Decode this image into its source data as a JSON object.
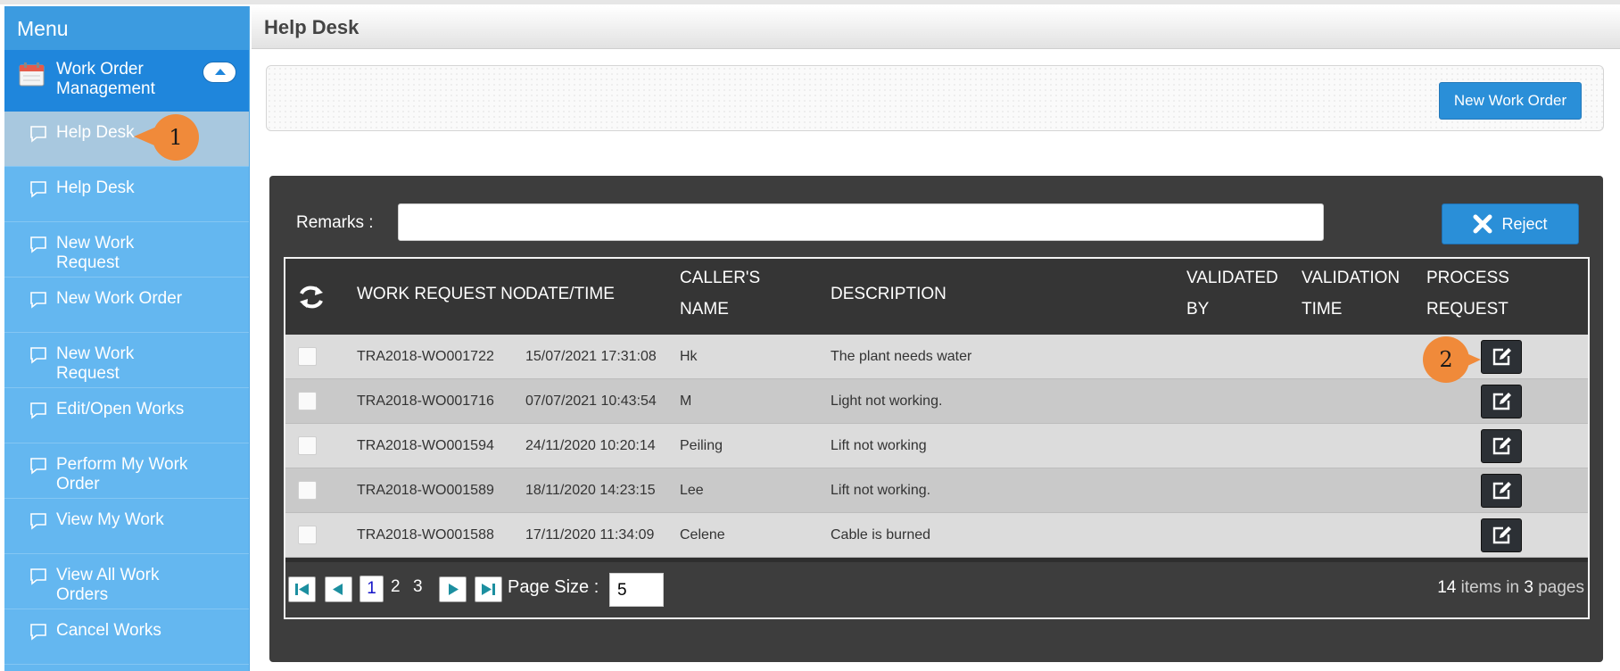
{
  "sidebar": {
    "header": "Menu",
    "module": {
      "label": "Work Order Management",
      "icon": "calendar-icon"
    },
    "items": [
      {
        "label": "Help Desk",
        "active": true
      },
      {
        "label": "Help Desk",
        "active": false
      },
      {
        "label": "New Work Request",
        "active": false
      },
      {
        "label": "New Work Order",
        "active": false
      },
      {
        "label": "New Work Request",
        "active": false
      },
      {
        "label": "Edit/Open Works",
        "active": false
      },
      {
        "label": "Perform My Work Order",
        "active": false
      },
      {
        "label": "View My Work",
        "active": false
      },
      {
        "label": "View All Work Orders",
        "active": false
      },
      {
        "label": "Cancel Works",
        "active": false
      }
    ]
  },
  "page": {
    "title": "Help Desk"
  },
  "toolbar": {
    "new_work_order_label": "New Work Order"
  },
  "remarks": {
    "label": "Remarks :",
    "value": ""
  },
  "reject": {
    "label": "Reject"
  },
  "grid": {
    "columns": {
      "work_request_no": "WORK REQUEST NO.",
      "date_time": "DATE/TIME",
      "callers_name_1": "CALLER'S",
      "callers_name_2": "NAME",
      "description": "DESCRIPTION",
      "validated_by_1": "VALIDATED",
      "validated_by_2": "BY",
      "validation_time_1": "VALIDATION",
      "validation_time_2": "TIME",
      "process_request_1": "PROCESS",
      "process_request_2": "REQUEST"
    },
    "rows": [
      {
        "wr_no": "TRA2018-WO001722",
        "datetime": "15/07/2021 17:31:08",
        "caller": "Hk",
        "description": "The plant needs water",
        "validated_by": "",
        "validation_time": ""
      },
      {
        "wr_no": "TRA2018-WO001716",
        "datetime": "07/07/2021 10:43:54",
        "caller": "M",
        "description": "Light not working.",
        "validated_by": "",
        "validation_time": ""
      },
      {
        "wr_no": "TRA2018-WO001594",
        "datetime": "24/11/2020 10:20:14",
        "caller": "Peiling",
        "description": "Lift not working",
        "validated_by": "",
        "validation_time": ""
      },
      {
        "wr_no": "TRA2018-WO001589",
        "datetime": "18/11/2020 14:23:15",
        "caller": "Lee",
        "description": "Lift not working.",
        "validated_by": "",
        "validation_time": ""
      },
      {
        "wr_no": "TRA2018-WO001588",
        "datetime": "17/11/2020 11:34:09",
        "caller": "Celene",
        "description": "Cable is burned",
        "validated_by": "",
        "validation_time": ""
      }
    ]
  },
  "pager": {
    "pages": [
      "1",
      "2",
      "3"
    ],
    "current_page": "1",
    "page_size_label": "Page Size :",
    "page_size_value": "5",
    "total_items": "14",
    "items_text": "items in",
    "total_pages": "3",
    "pages_text": "pages"
  },
  "annotations": {
    "callout_1": "1",
    "callout_2": "2"
  },
  "colors": {
    "sidebar": "#64b7f0",
    "module": "#1f86dc",
    "accent_button": "#2a8fd8",
    "grid_dark": "#3d3d3d",
    "callout": "#f08a3a"
  }
}
